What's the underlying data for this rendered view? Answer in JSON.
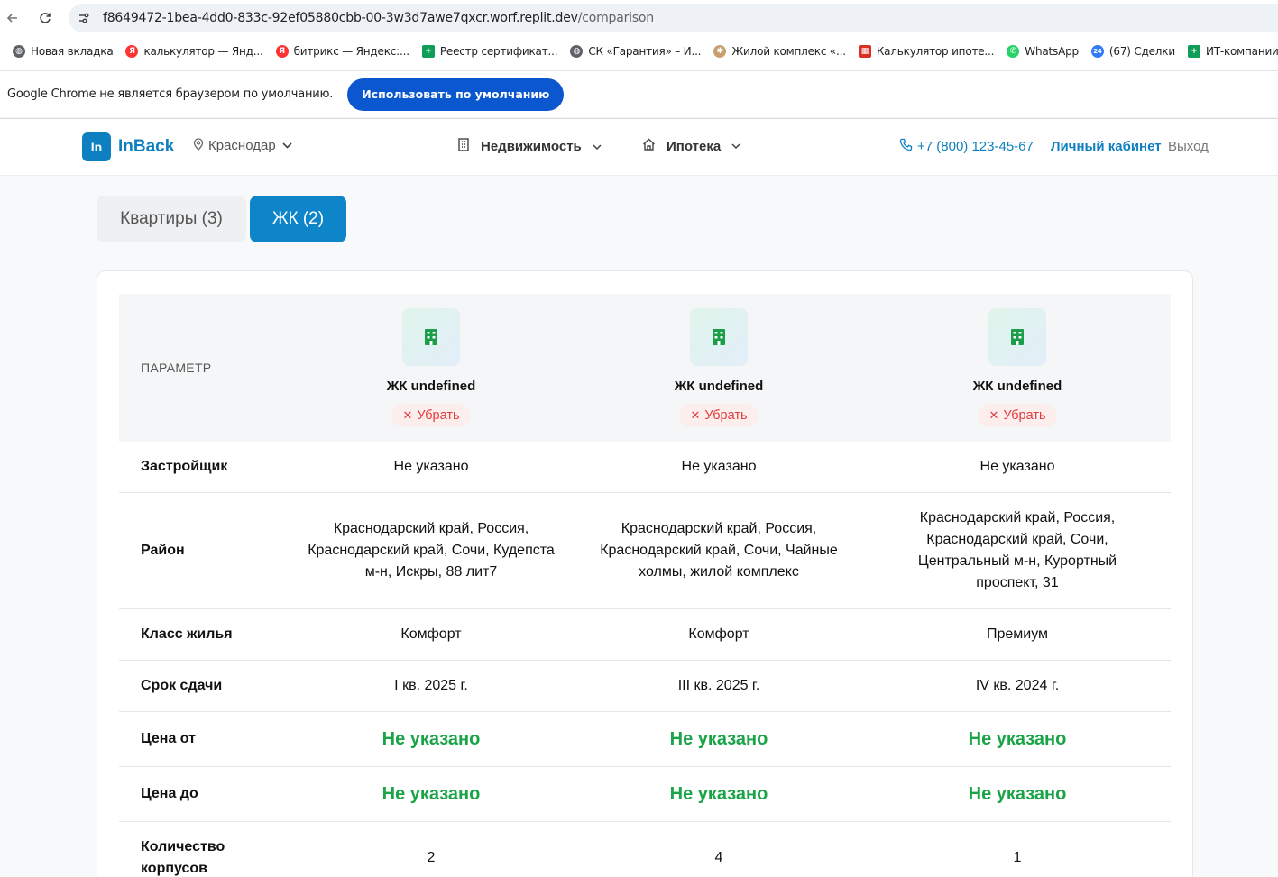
{
  "browser": {
    "url_host": "f8649472-1bea-4dd0-833c-92ef05880cbb-00-3w3d7awe7qxcr.worf.replit.dev",
    "url_path": "/comparison",
    "bookmarks": [
      {
        "label": "Новая вкладка",
        "icon": "globe-icon",
        "color": "#5f6368"
      },
      {
        "label": "калькулятор — Янд...",
        "icon": "yandex-icon",
        "color": "#f33"
      },
      {
        "label": "битрикс — Яндекс:...",
        "icon": "yandex-icon",
        "color": "#f33"
      },
      {
        "label": "Реестр сертификат...",
        "icon": "sheets-icon",
        "color": "#0f9d58"
      },
      {
        "label": "СК «Гарантия» – И...",
        "icon": "globe-icon",
        "color": "#5f6368"
      },
      {
        "label": "Жилой комплекс «...",
        "icon": "shell-icon",
        "color": "#c8a070"
      },
      {
        "label": "Калькулятор ипоте...",
        "icon": "calculator-icon",
        "color": "#d93025"
      },
      {
        "label": "WhatsApp",
        "icon": "whatsapp-icon",
        "color": "#25d366"
      },
      {
        "label": "(67) Сделки",
        "icon": "bitrix-icon",
        "color": "#2f7cf6"
      },
      {
        "label": "ИТ-компании пере...",
        "icon": "sheets-icon",
        "color": "#0f9d58"
      }
    ],
    "infobar_text": "Google Chrome не является браузером по умолчанию.",
    "infobar_button": "Использовать по умолчанию"
  },
  "header": {
    "logo_mark": "In",
    "logo_text": "InBack",
    "city": "Краснодар",
    "menu": [
      {
        "label": "Недвижимость",
        "icon": "building-icon"
      },
      {
        "label": "Ипотека",
        "icon": "home-icon"
      }
    ],
    "phone": "+7 (800) 123-45-67",
    "cabinet": "Личный кабинет",
    "logout": "Выход"
  },
  "tabs": {
    "apartments": "Квартиры (3)",
    "complexes": "ЖК (2)",
    "active": "complexes"
  },
  "comparison": {
    "param_header": "ПАРАМЕТР",
    "remove_label": "Убрать",
    "columns": [
      {
        "title": "ЖК undefined"
      },
      {
        "title": "ЖК undefined"
      },
      {
        "title": "ЖК undefined"
      }
    ],
    "rows": [
      {
        "label": "Застройщик",
        "values": [
          "Не указано",
          "Не указано",
          "Не указано"
        ]
      },
      {
        "label": "Район",
        "values": [
          "Краснодарский край, Россия, Краснодарский край, Сочи, Кудепста м-н, Искры, 88 лит7",
          "Краснодарский край, Россия, Краснодарский край, Сочи, Чайные холмы, жилой комплекс",
          "Краснодарский край, Россия, Краснодарский край, Сочи, Центральный м-н, Курортный проспект, 31"
        ]
      },
      {
        "label": "Класс жилья",
        "values": [
          "Комфорт",
          "Комфорт",
          "Премиум"
        ]
      },
      {
        "label": "Срок сдачи",
        "values": [
          "I кв. 2025 г.",
          "III кв. 2025 г.",
          "IV кв. 2024 г."
        ]
      },
      {
        "label": "Цена от",
        "values": [
          "Не указано",
          "Не указано",
          "Не указано"
        ]
      },
      {
        "label": "Цена до",
        "values": [
          "Не указано",
          "Не указано",
          "Не указано"
        ]
      },
      {
        "label": "Количество корпусов",
        "values": [
          "2",
          "4",
          "1"
        ]
      }
    ],
    "price_color": "#1aa447",
    "accent_color": "#0e85c9",
    "remove_color": "#e23d3d"
  }
}
